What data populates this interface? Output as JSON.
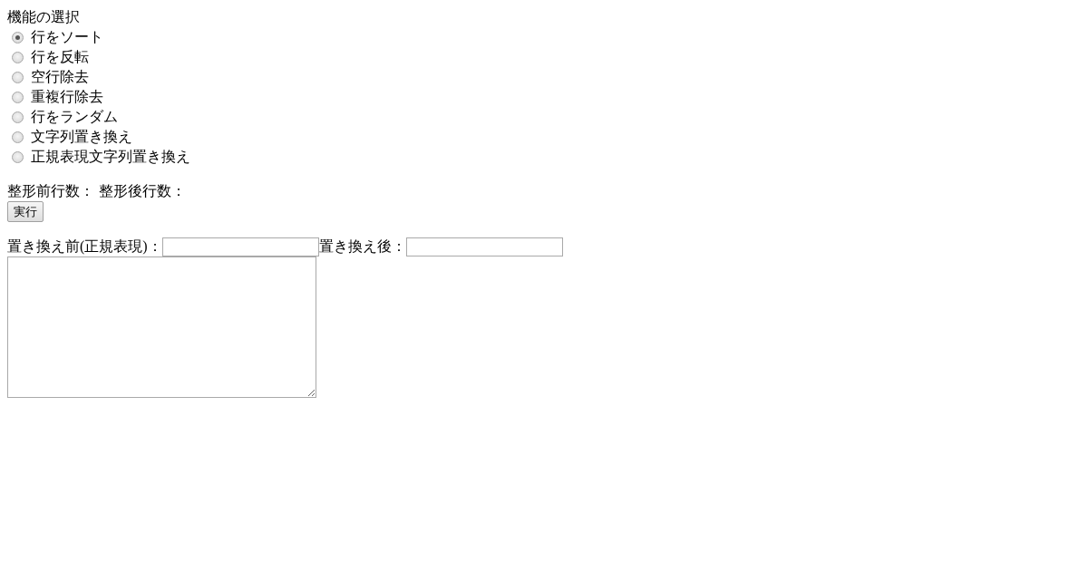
{
  "section_title": "機能の選択",
  "functions": [
    {
      "label": "行をソート",
      "selected": true
    },
    {
      "label": "行を反転",
      "selected": false
    },
    {
      "label": "空行除去",
      "selected": false
    },
    {
      "label": "重複行除去",
      "selected": false
    },
    {
      "label": "行をランダム",
      "selected": false
    },
    {
      "label": "文字列置き換え",
      "selected": false
    },
    {
      "label": "正規表現文字列置き換え",
      "selected": false
    }
  ],
  "line_counts": [
    {
      "label": "整形前行数："
    },
    {
      "label": "整形後行数："
    }
  ],
  "run_button": {
    "label": "実行"
  },
  "replace_fields": [
    {
      "label": "置き換え前(正規表現)："
    },
    {
      "label": "置き換え後："
    }
  ]
}
